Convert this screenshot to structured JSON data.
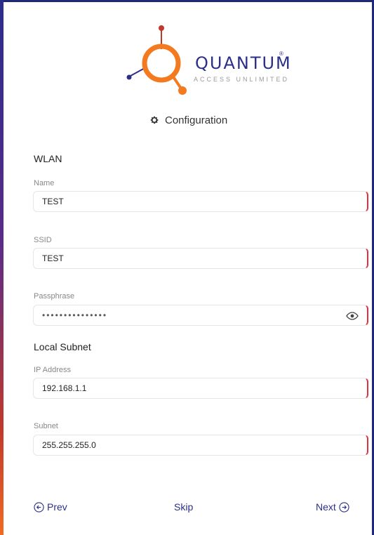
{
  "brand": {
    "name": "QUANTUM",
    "registered": "®",
    "tagline": "ACCESS UNLIMITED",
    "colors": {
      "orange": "#f47a20",
      "navy": "#2b2f8a",
      "red": "#c0392b"
    }
  },
  "header": {
    "title": "Configuration",
    "icon": "gear-icon"
  },
  "wlan": {
    "section_title": "WLAN",
    "name": {
      "label": "Name",
      "value": "TEST"
    },
    "ssid": {
      "label": "SSID",
      "value": "TEST"
    },
    "passphrase": {
      "label": "Passphrase",
      "value": "•••••••••••••••",
      "icon": "eye-icon"
    }
  },
  "subnet": {
    "section_title": "Local Subnet",
    "ip": {
      "label": "IP Address",
      "value": "192.168.1.1"
    },
    "mask": {
      "label": "Subnet",
      "value": "255.255.255.0"
    }
  },
  "footer": {
    "prev": "Prev",
    "skip": "Skip",
    "next": "Next"
  },
  "accent": {
    "invalid_border": "#e0313f",
    "link": "#2b2f8a"
  }
}
